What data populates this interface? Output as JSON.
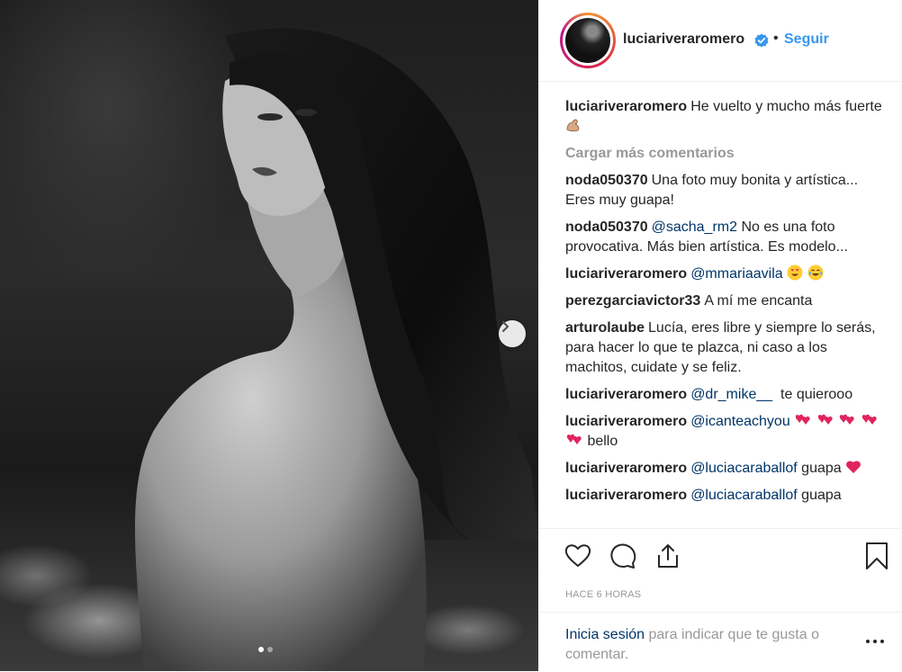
{
  "post": {
    "username": "luciariveraromero",
    "separator": "•",
    "follow_label": "Seguir",
    "caption": {
      "user": "luciariveraromero",
      "text": "He vuelto y mucho más fuerte"
    },
    "load_more_label": "Cargar más comentarios",
    "comments": [
      {
        "user": "noda050370",
        "text": "Una foto muy bonita y artística... Eres muy guapa!"
      },
      {
        "user": "noda050370",
        "mention": "@sacha_rm2",
        "text": "No es una foto provocativa. Más bien artística. Es modelo..."
      },
      {
        "user": "luciariveraromero",
        "mention": "@mmariaavila",
        "text": ""
      },
      {
        "user": "perezgarciavictor33",
        "text": "A mí me encanta"
      },
      {
        "user": "arturolaube",
        "text": "Lucía, eres libre y siempre lo serás, para hacer lo que te plazca, ni caso a los machitos, cuidate y se feliz."
      },
      {
        "user": "luciariveraromero",
        "mention": "@dr_mike__",
        "text": "te quierooo"
      },
      {
        "user": "luciariveraromero",
        "mention": "@icanteachyou",
        "text": "bello"
      },
      {
        "user": "luciariveraromero",
        "mention": "@luciacaraballof",
        "text": "guapa"
      },
      {
        "user": "luciariveraromero",
        "mention": "@luciacaraballof",
        "text": "guapa"
      }
    ],
    "time_label": "HACE 6 HORAS",
    "login_link": "Inicia sesión",
    "login_rest": "para indicar que te gusta o comentar.",
    "carousel": {
      "current": 1,
      "total": 2
    },
    "colors": {
      "accent": "#3897f0",
      "mention": "#003569",
      "muted": "#999999",
      "text": "#262626",
      "heart": "#ed4956"
    }
  }
}
